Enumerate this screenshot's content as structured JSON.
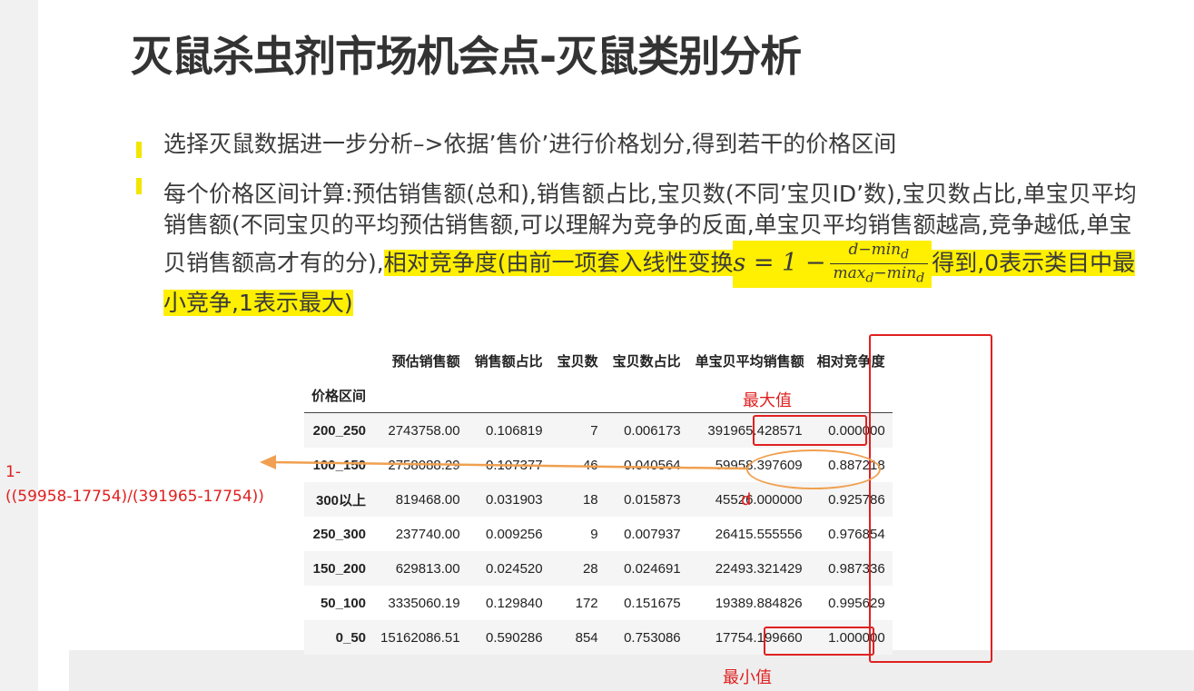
{
  "title": "灭鼠杀虫剂市场机会点-灭鼠类别分析",
  "bullets": {
    "p1": "选择灭鼠数据进一步分析–>依据’售价’进行价格划分,得到若干的价格区间",
    "p2_plain": "每个价格区间计算:预估销售额(总和),销售额占比,宝贝数(不同’宝贝ID’数),宝贝数占比,单宝贝平均销售额(不同宝贝的平均预估销售额,可以理解为竞争的反面,单宝贝平均销售额越高,竞争越低,单宝贝销售额高才有的分),",
    "p2_hl1": "相对竞争度(由前一项套入线性变换",
    "formula_lhs": "s = 1 −",
    "formula_num": "d−min",
    "formula_den": "max",
    "formula_den2": "−min",
    "formula_sub": "d",
    "p2_hl2": "得到,0表示类目中最小竞争,1表示最大)"
  },
  "table": {
    "columns": [
      "预估销售额",
      "销售额占比",
      "宝贝数",
      "宝贝数占比",
      "单宝贝平均销售额",
      "相对竞争度"
    ],
    "index_name": "价格区间",
    "rows": [
      {
        "label": "200_250",
        "sales": "2743758.00",
        "sales_ratio": "0.106819",
        "count": "7",
        "count_ratio": "0.006173",
        "avg": "391965.428571",
        "rel": "0.000000"
      },
      {
        "label": "100_150",
        "sales": "2758088.29",
        "sales_ratio": "0.107377",
        "count": "46",
        "count_ratio": "0.040564",
        "avg": "59958.397609",
        "rel": "0.887218"
      },
      {
        "label": "300以上",
        "sales": "819468.00",
        "sales_ratio": "0.031903",
        "count": "18",
        "count_ratio": "0.015873",
        "avg": "45526.000000",
        "rel": "0.925786"
      },
      {
        "label": "250_300",
        "sales": "237740.00",
        "sales_ratio": "0.009256",
        "count": "9",
        "count_ratio": "0.007937",
        "avg": "26415.555556",
        "rel": "0.976854"
      },
      {
        "label": "150_200",
        "sales": "629813.00",
        "sales_ratio": "0.024520",
        "count": "28",
        "count_ratio": "0.024691",
        "avg": "22493.321429",
        "rel": "0.987336"
      },
      {
        "label": "50_100",
        "sales": "3335060.19",
        "sales_ratio": "0.129840",
        "count": "172",
        "count_ratio": "0.151675",
        "avg": "19389.884826",
        "rel": "0.995629"
      },
      {
        "label": "0_50",
        "sales": "15162086.51",
        "sales_ratio": "0.590286",
        "count": "854",
        "count_ratio": "0.753086",
        "avg": "17754.199660",
        "rel": "1.000000"
      }
    ]
  },
  "annotations": {
    "max_label": "最大值",
    "min_label": "最小值",
    "d_label": "d",
    "formula_line1": "1-",
    "formula_line2": "((59958-17754)/(391965-17754))",
    "accent_red": "#e02020",
    "accent_orange": "#f0a050"
  }
}
